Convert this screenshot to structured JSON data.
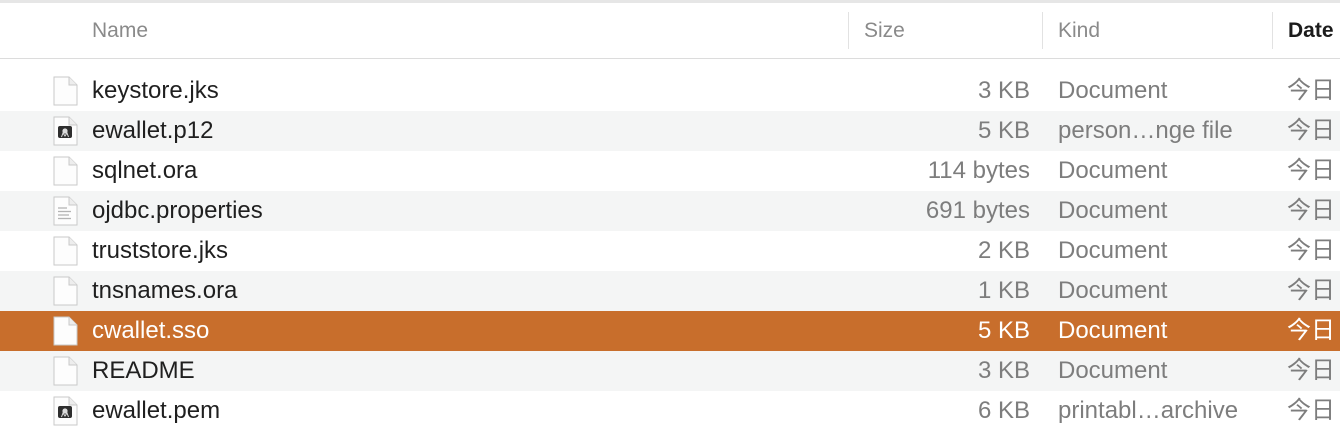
{
  "columns": {
    "name": "Name",
    "size": "Size",
    "kind": "Kind",
    "date": "Date"
  },
  "files": [
    {
      "name": "keystore.jks",
      "size": "3 KB",
      "kind": "Document",
      "date": "今日",
      "icon": "document-icon"
    },
    {
      "name": "ewallet.p12",
      "size": "5 KB",
      "kind": "person…nge file",
      "date": "今日",
      "icon": "certificate-icon"
    },
    {
      "name": "sqlnet.ora",
      "size": "114 bytes",
      "kind": "Document",
      "date": "今日",
      "icon": "document-icon"
    },
    {
      "name": "ojdbc.properties",
      "size": "691 bytes",
      "kind": "Document",
      "date": "今日",
      "icon": "text-document-icon"
    },
    {
      "name": "truststore.jks",
      "size": "2 KB",
      "kind": "Document",
      "date": "今日",
      "icon": "document-icon"
    },
    {
      "name": "tnsnames.ora",
      "size": "1 KB",
      "kind": "Document",
      "date": "今日",
      "icon": "document-icon"
    },
    {
      "name": "cwallet.sso",
      "size": "5 KB",
      "kind": "Document",
      "date": "今日",
      "icon": "document-icon",
      "selected": true
    },
    {
      "name": "README",
      "size": "3 KB",
      "kind": "Document",
      "date": "今日",
      "icon": "document-icon"
    },
    {
      "name": "ewallet.pem",
      "size": "6 KB",
      "kind": "printabl…archive",
      "date": "今日",
      "icon": "certificate-icon"
    }
  ],
  "colors": {
    "selection": "#c86e2c",
    "alternate_row": "#f4f5f5"
  }
}
